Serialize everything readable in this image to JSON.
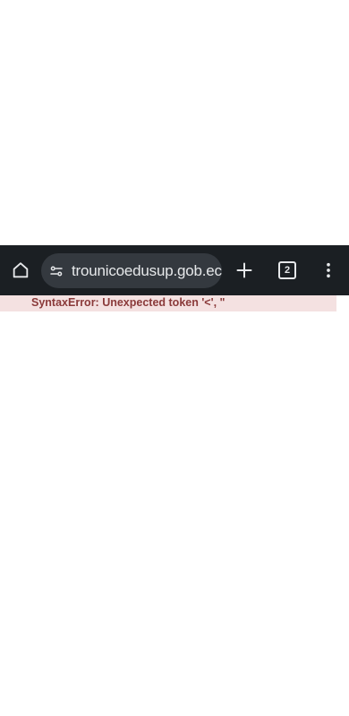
{
  "toolbar": {
    "url": "trounicoedusup.gob.ec",
    "tab_count": "2",
    "icons": {
      "home": "home-icon",
      "site_settings": "tune-icon",
      "new_tab": "plus-icon",
      "tabs": "tab-switcher-icon",
      "menu": "more-vert-icon"
    },
    "colors": {
      "background": "#1b1f23",
      "omnibox": "#34393f",
      "foreground": "#e6e8ea"
    }
  },
  "content": {
    "error_message": "SyntaxError: Unexpected token '<', \"",
    "colors": {
      "error_background": "#f4e1e1",
      "error_text": "#8a3a3a"
    }
  }
}
